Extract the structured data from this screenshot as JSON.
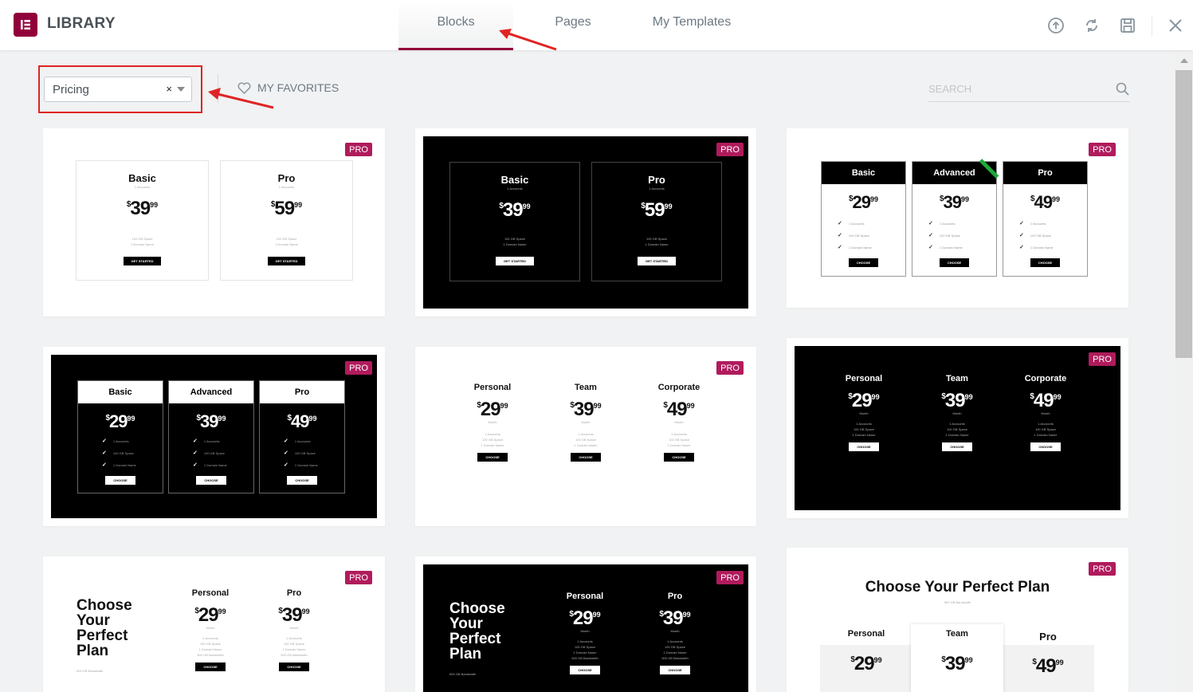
{
  "header": {
    "title": "LIBRARY",
    "tabs": [
      {
        "label": "Blocks",
        "active": true
      },
      {
        "label": "Pages"
      },
      {
        "label": "My Templates"
      }
    ],
    "icons": [
      "upload-icon",
      "sync-icon",
      "save-icon",
      "close-icon"
    ]
  },
  "toolbar": {
    "filter_value": "Pricing",
    "clear_symbol": "×",
    "favorites_label": "My Favorites",
    "search_placeholder": "SEARCH"
  },
  "colors": {
    "accent": "#92003b",
    "pro_badge": "#b01b5c",
    "annotation": "#e02424"
  },
  "badge": "PRO",
  "previews": {
    "currency": "$",
    "cents": "99",
    "per": "Month",
    "cta": "GET STARTED",
    "choose": "CHOOSE",
    "headline": "Choose Your Perfect Plan",
    "headline_lines": [
      "Choose",
      "Your",
      "Perfect",
      "Plan"
    ],
    "tier_names": [
      "Basic",
      "Pro",
      "Advanced",
      "Personal",
      "Team",
      "Corporate"
    ],
    "amounts": [
      "39",
      "59",
      "29",
      "49"
    ],
    "features": [
      "1 Accounts",
      "100 GB Space",
      "1 Domain Name",
      "500 GB Bandwidth"
    ]
  }
}
